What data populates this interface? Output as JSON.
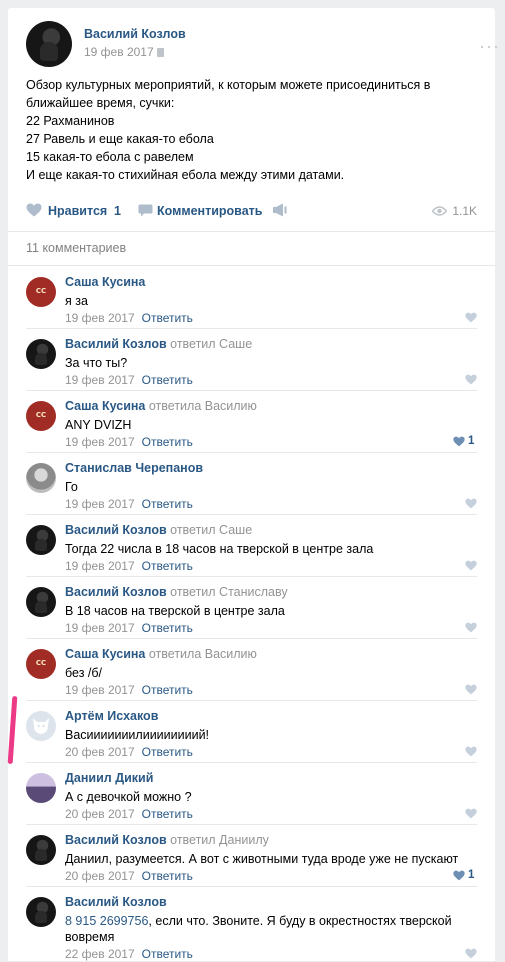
{
  "post": {
    "author": "Василий Козлов",
    "date": "19 фев 2017",
    "text": "Обзор культурных мероприятий, к которым можете присоединиться в ближайшее время, сучки:\n22 Рахманинов\n27 Равель и еще какая-то ебола\n15 какая-то ебола с равелем\nИ еще какая-то стихийная ебола между этими датами.",
    "like_label": "Нравится",
    "like_count": "1",
    "comment_label": "Комментировать",
    "views": "1.1K"
  },
  "comments_header": "11 комментариев",
  "reply_label": "Ответить",
  "comments": [
    {
      "author": "Саша Кусина",
      "reply_to": "",
      "text": "я за",
      "date": "19 фев 2017",
      "likes": ""
    },
    {
      "author": "Василий Козлов",
      "reply_to": "ответил Саше",
      "text": "За что ты?",
      "date": "19 фев 2017",
      "likes": ""
    },
    {
      "author": "Саша Кусина",
      "reply_to": "ответила Василию",
      "text": "ANY DVIZH",
      "date": "19 фев 2017",
      "likes": "1"
    },
    {
      "author": "Станислав Черепанов",
      "reply_to": "",
      "text": "Го",
      "date": "19 фев 2017",
      "likes": ""
    },
    {
      "author": "Василий Козлов",
      "reply_to": "ответил Саше",
      "text": "Тогда 22 числа в 18 часов на тверской в центре зала",
      "date": "19 фев 2017",
      "likes": ""
    },
    {
      "author": "Василий Козлов",
      "reply_to": "ответил Станиславу",
      "text": "В 18 часов на тверской в центре зала",
      "date": "19 фев 2017",
      "likes": ""
    },
    {
      "author": "Саша Кусина",
      "reply_to": "ответила Василию",
      "text": "без /б/",
      "date": "19 фев 2017",
      "likes": ""
    },
    {
      "author": "Артём Исхаков",
      "reply_to": "",
      "text": "Васииииииилиииииииий!",
      "date": "20 фев 2017",
      "likes": ""
    },
    {
      "author": "Даниил Дикий",
      "reply_to": "",
      "text": "А с девочкой можно ?",
      "date": "20 фев 2017",
      "likes": ""
    },
    {
      "author": "Василий Козлов",
      "reply_to": "ответил Даниилу",
      "text": "Даниил, разумеется. А вот с животными туда вроде уже не пускают",
      "date": "20 фев 2017",
      "likes": "1"
    }
  ],
  "last_comment": {
    "author": "Василий Козлов",
    "phone": "8 915 2699756",
    "text_rest": ", если что. Звоните. Я буду в окрестностях тверской вовремя",
    "date": "22 фев 2017"
  },
  "colors": {
    "link": "#2a5885",
    "muted": "#939393",
    "highlight": "#ec3a86"
  }
}
